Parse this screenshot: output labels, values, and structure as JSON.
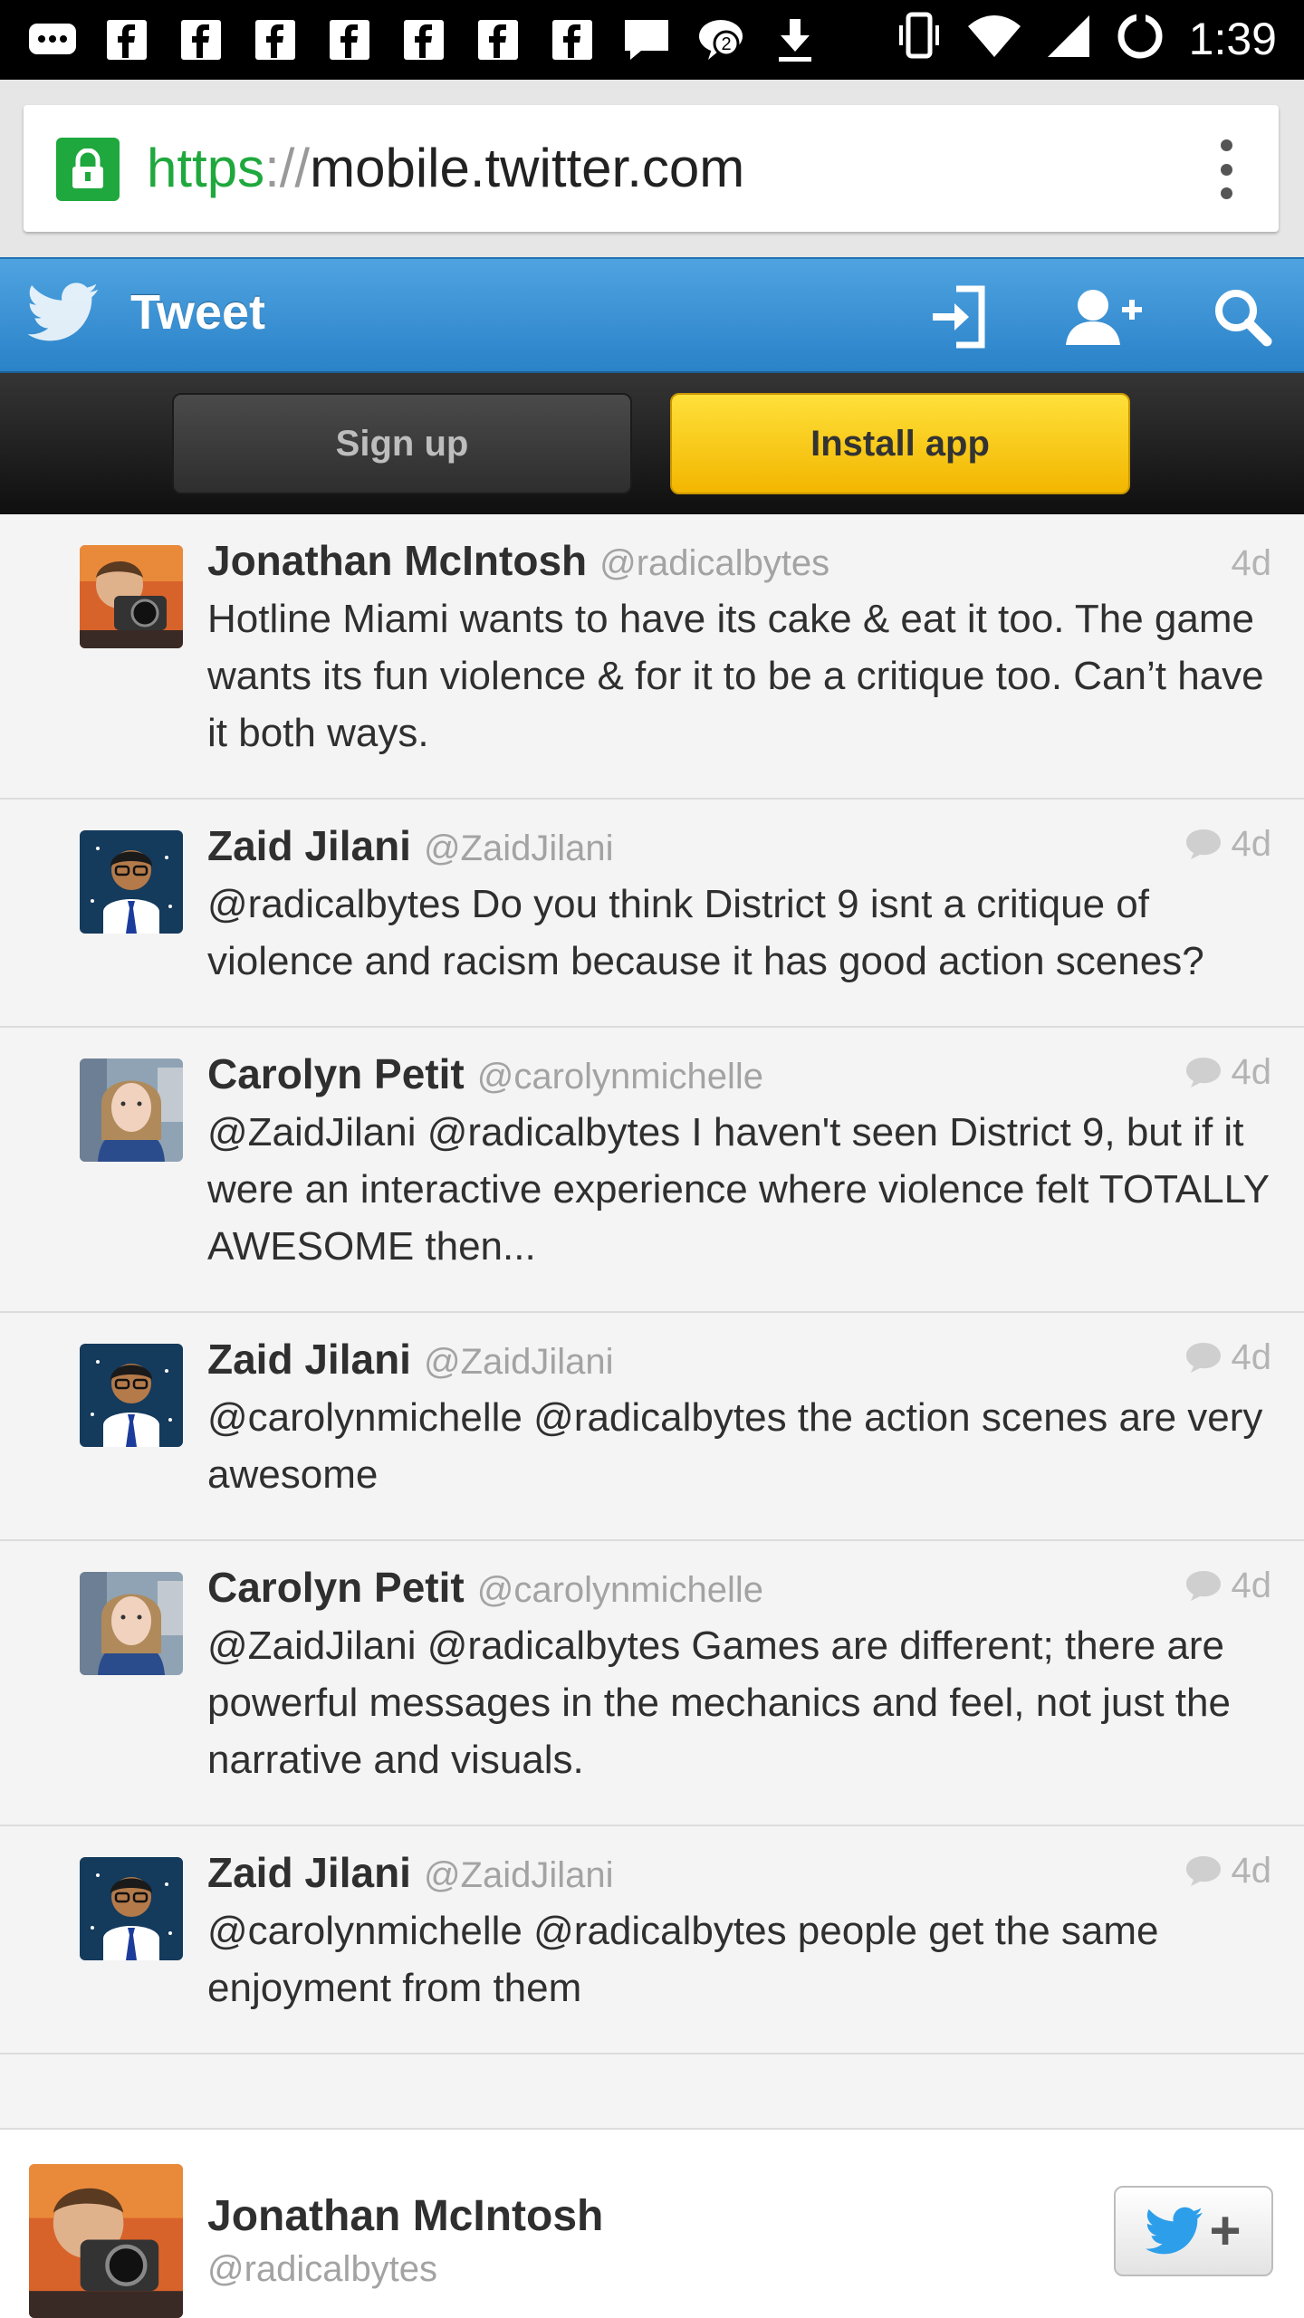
{
  "status_bar": {
    "time": "1:39",
    "notification_count": "2",
    "icons": [
      "messages-icon",
      "facebook-icon",
      "facebook-icon",
      "facebook-icon",
      "facebook-icon",
      "facebook-icon",
      "facebook-icon",
      "facebook-icon",
      "chat-icon",
      "hangouts-icon",
      "download-icon",
      "vibrate-icon",
      "wifi-icon",
      "signal-icon",
      "sync-icon"
    ]
  },
  "browser": {
    "url_scheme": "https",
    "url_separator": "://",
    "url_host": "mobile.twitter.com"
  },
  "header": {
    "title": "Tweet",
    "brand_color": "#2a82c8"
  },
  "actions": {
    "signup_label": "Sign up",
    "install_label": "Install app"
  },
  "tweets": [
    {
      "name": "Jonathan McIntosh",
      "handle": "@radicalbytes",
      "time": "4d",
      "reply": false,
      "text": "Hotline Miami wants to have its cake & eat it too. The game wants its fun violence & for it to be a critique too. Can’t have it both ways.",
      "avatar": "jonathan"
    },
    {
      "name": "Zaid Jilani",
      "handle": "@ZaidJilani",
      "time": "4d",
      "reply": true,
      "text": "@radicalbytes Do you think District 9 isnt a critique of violence and racism because it has good action scenes?",
      "avatar": "zaid"
    },
    {
      "name": "Carolyn Petit",
      "handle": "@carolynmichelle",
      "time": "4d",
      "reply": true,
      "text": "@ZaidJilani @radicalbytes I haven't seen District 9, but if it were an interactive experience where violence felt TOTALLY AWESOME then...",
      "avatar": "carolyn"
    },
    {
      "name": "Zaid Jilani",
      "handle": "@ZaidJilani",
      "time": "4d",
      "reply": true,
      "text": "@carolynmichelle @radicalbytes the action scenes are very awesome",
      "avatar": "zaid"
    },
    {
      "name": "Carolyn Petit",
      "handle": "@carolynmichelle",
      "time": "4d",
      "reply": true,
      "text": "@ZaidJilani @radicalbytes Games are different; there are powerful messages in the mechanics and feel, not just the narrative and visuals.",
      "avatar": "carolyn"
    },
    {
      "name": "Zaid Jilani",
      "handle": "@ZaidJilani",
      "time": "4d",
      "reply": true,
      "text": "@carolynmichelle @radicalbytes people get the same enjoyment from them",
      "avatar": "zaid"
    }
  ],
  "profile": {
    "name": "Jonathan McIntosh",
    "handle": "@radicalbytes",
    "follow_symbol": "+"
  }
}
